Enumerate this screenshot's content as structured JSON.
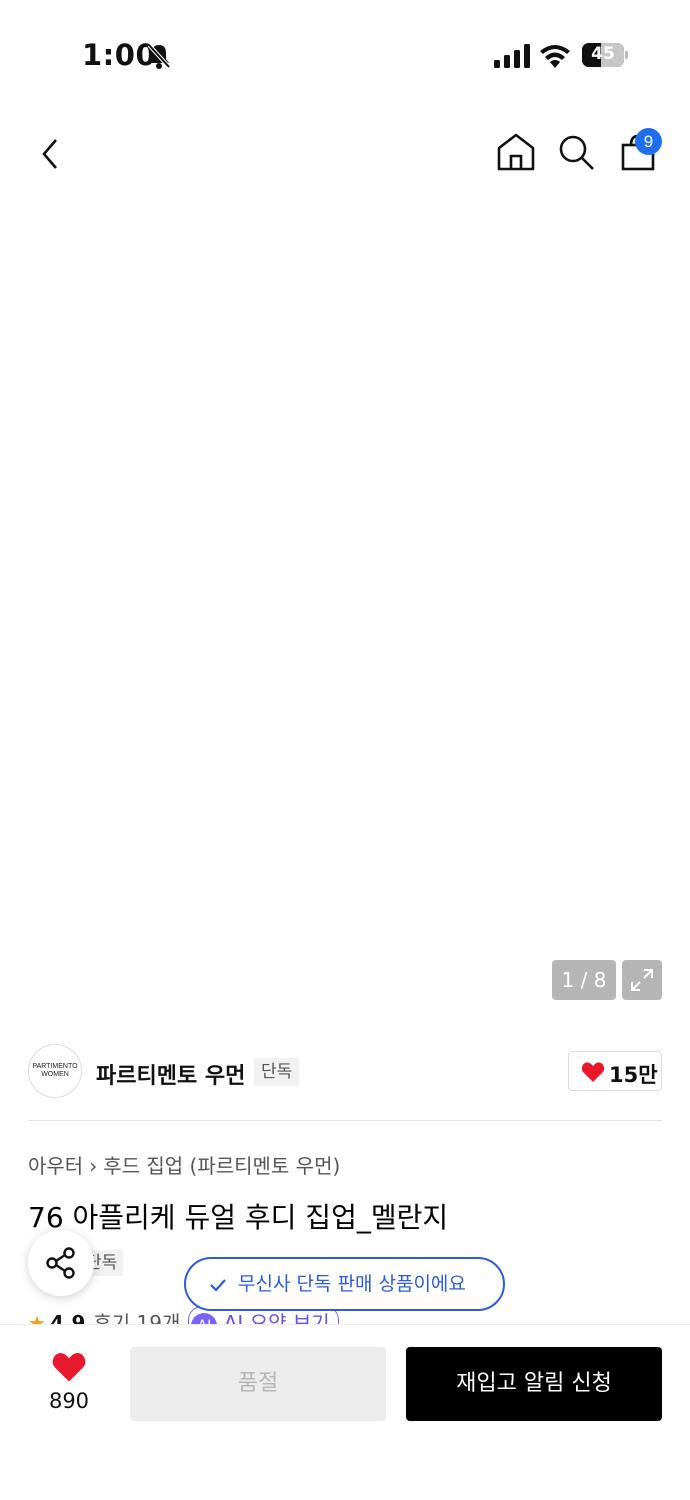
{
  "status_bar": {
    "time": "1:00",
    "battery": "45",
    "battery_level_percent": 45,
    "icons": [
      "bell-off-icon",
      "signal-icon",
      "wifi-icon",
      "battery-icon"
    ]
  },
  "nav": {
    "icons": [
      "back-arrow-icon",
      "home-icon",
      "search-icon",
      "shopping-bag-icon"
    ],
    "cart_badge": "9",
    "accent_color": "#1f6ff0"
  },
  "gallery": {
    "page_indicator": "1 / 8",
    "expand_icon": "expand-icon"
  },
  "brand": {
    "logo_line1": "PARTIMENTO",
    "logo_line2": "WOMEN",
    "name": "파르티멘토 우먼",
    "tag": "단독",
    "likes": "15만"
  },
  "product": {
    "breadcrumb": [
      "아우터",
      "후드 집업 (파르티멘토 우먼)"
    ],
    "title": "76 아플리케 듀얼 후디 집업_멜란지",
    "exclusive_tag": "단독",
    "rating": "4.9",
    "reviews": "후기 19개",
    "ai_badge": "AI",
    "ai_summary_label": "AI 요약 보기"
  },
  "toast": {
    "text": "무신사 단독 판매 상품이에요",
    "color": "#2f5ad8"
  },
  "bottom_bar": {
    "wish_count": "890",
    "soldout_label": "품절",
    "restock_label": "재입고 알림 신청"
  }
}
